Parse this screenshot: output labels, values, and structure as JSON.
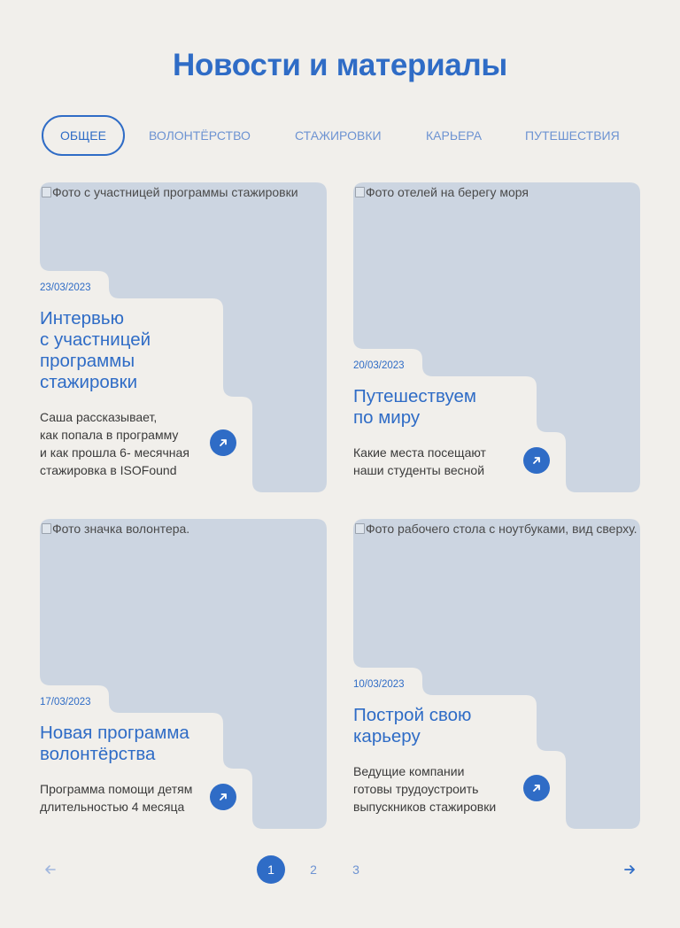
{
  "page_title": "Новости и материалы",
  "colors": {
    "accent": "#2f6cc6",
    "background": "#f1efeb",
    "image_placeholder": "#ccd5e1"
  },
  "tabs": [
    {
      "label": "ОБЩЕЕ",
      "active": true
    },
    {
      "label": "ВОЛОНТЁРСТВО",
      "active": false
    },
    {
      "label": "СТАЖИРОВКИ",
      "active": false
    },
    {
      "label": "КАРЬЕРА",
      "active": false
    },
    {
      "label": "ПУТЕШЕСТВИЯ",
      "active": false
    }
  ],
  "cards": [
    {
      "image_alt": "Фото с участницей программы стажировки",
      "date": "23/03/2023",
      "title": "Интервью\nс участницей\nпрограммы\nстажировки",
      "description": "Саша рассказывает,\nкак попала в программу\nи как прошла 6- месячная\nстажировка в ISOFound",
      "link_icon": "arrow-up-right-icon"
    },
    {
      "image_alt": "Фото отелей на берегу моря",
      "date": "20/03/2023",
      "title": "Путешествуем\nпо миру",
      "description": "Какие места посещают\nнаши студенты весной",
      "link_icon": "arrow-up-right-icon"
    },
    {
      "image_alt": "Фото значка волонтера.",
      "date": "17/03/2023",
      "title": "Новая программа\nволонтёрства",
      "description": "Программа помощи детям\nдлительностью 4 месяца",
      "link_icon": "arrow-up-right-icon"
    },
    {
      "image_alt": "Фото рабочего стола с ноутбуками, вид сверху.",
      "date": "10/03/2023",
      "title": "Построй свою\nкарьеру",
      "description": "Ведущие компании\nготовы трудоустроить\nвыпускников стажировки",
      "link_icon": "arrow-up-right-icon"
    }
  ],
  "pagination": {
    "pages": [
      "1",
      "2",
      "3"
    ],
    "current": "1",
    "prev_icon": "arrow-left-icon",
    "next_icon": "arrow-right-icon"
  }
}
